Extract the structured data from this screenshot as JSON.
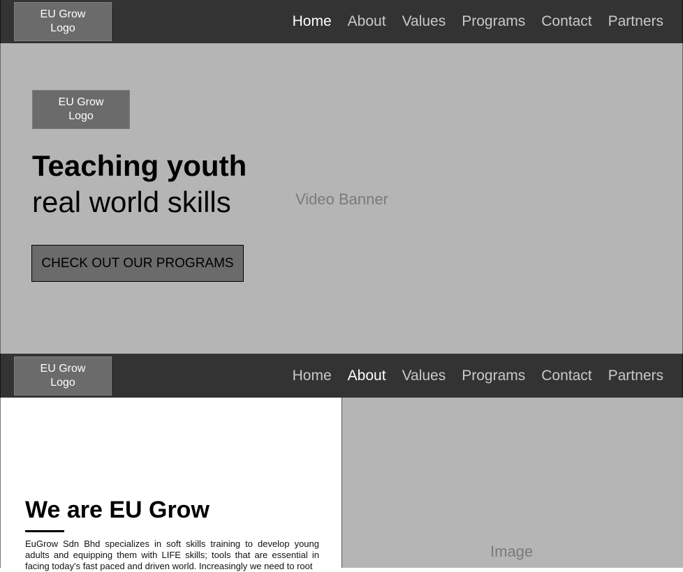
{
  "nav_top": {
    "logo_text": "EU Grow\nLogo",
    "links": [
      "Home",
      "About",
      "Values",
      "Programs",
      "Contact",
      "Partners"
    ],
    "active": "Home"
  },
  "hero": {
    "logo_text": "EU Grow\nLogo",
    "title_bold": "Teaching youth",
    "title_light": "real world skills",
    "cta_label": "CHECK OUT OUR PROGRAMS",
    "video_label": "Video Banner"
  },
  "nav_second": {
    "logo_text": "EU Grow\nLogo",
    "links": [
      "Home",
      "About",
      "Values",
      "Programs",
      "Contact",
      "Partners"
    ],
    "active": "About"
  },
  "about": {
    "heading": "We are EU Grow",
    "paragraph": "EuGrow Sdn Bhd specializes in soft skills training to develop young adults and equipping them with LIFE skills; tools that are essential in facing today's fast paced and driven world. Increasingly we need to root",
    "image_label": "Image"
  },
  "colors": {
    "navbar_bg": "#333333",
    "placeholder_gray": "#b5b5b5",
    "logo_box": "#6b6b6b",
    "nav_active": "#ffffff",
    "nav_inactive": "#c9c9c9"
  }
}
